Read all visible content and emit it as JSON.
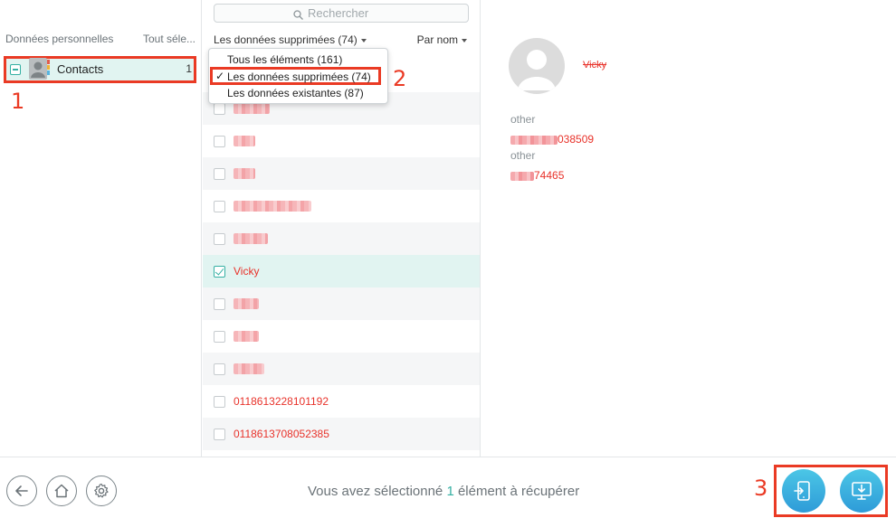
{
  "sidebar": {
    "header_left": "Données personnelles",
    "header_right": "Tout séle...",
    "items": [
      {
        "label": "Contacts",
        "count": "1",
        "icon": "contacts-icon"
      }
    ]
  },
  "annotations": {
    "one": "1",
    "two": "2",
    "three": "3"
  },
  "search": {
    "placeholder": "Rechercher"
  },
  "toolbar": {
    "filter_label": "Les données supprimées (74)",
    "sort_label": "Par nom"
  },
  "dropdown": {
    "options": [
      {
        "label": "Tous les éléments (161)",
        "selected": false
      },
      {
        "label": "Les données supprimées (74)",
        "selected": true
      },
      {
        "label": "Les données existantes (87)",
        "selected": false
      }
    ],
    "check": "✓"
  },
  "list": {
    "rows": [
      {
        "name": "",
        "blurred": true,
        "checked": false
      },
      {
        "name": "",
        "blurred": true,
        "checked": false
      },
      {
        "name": "",
        "blurred": true,
        "checked": false
      },
      {
        "name": "",
        "blurred": true,
        "checked": false
      },
      {
        "name": "",
        "blurred": true,
        "checked": false
      },
      {
        "name": "",
        "blurred": true,
        "checked": false
      },
      {
        "name": "Vicky",
        "blurred": false,
        "checked": true
      },
      {
        "name": "",
        "blurred": true,
        "checked": false
      },
      {
        "name": "",
        "blurred": true,
        "checked": false
      },
      {
        "name": "",
        "blurred": true,
        "checked": false
      },
      {
        "name": "0118613228101192",
        "blurred": false,
        "checked": false
      },
      {
        "name": "0118613708052385",
        "blurred": false,
        "checked": false
      }
    ]
  },
  "detail": {
    "name": "Vicky",
    "fields": [
      {
        "label": "other",
        "value_suffix": "038509"
      },
      {
        "label": "other",
        "value_suffix": "74465"
      }
    ]
  },
  "status": {
    "prefix": "Vous avez sélectionné ",
    "count": "1",
    "suffix": " élément à récupérer"
  },
  "colors": {
    "accent": "#35b0a3",
    "deleted_text": "#e8322a",
    "highlight_frame": "#ea3a24",
    "action_button": "#2e9bd8"
  }
}
